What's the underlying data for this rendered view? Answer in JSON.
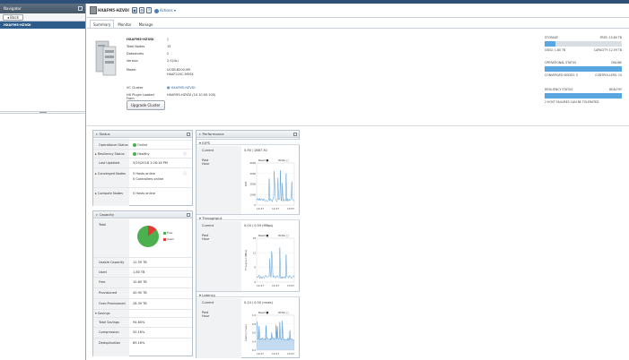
{
  "navigator": {
    "title": "Navigator",
    "back_label": "Back",
    "selected_item": "HXAFM5-HZVDI"
  },
  "header": {
    "object_name": "HXAFM5-HZVDI",
    "actions_label": "Actions",
    "toolbar_icons": [
      "snapshot-icon",
      "manage-icon",
      "help-icon"
    ]
  },
  "tabs": [
    {
      "label": "Summary",
      "active": true
    },
    {
      "label": "Monitor",
      "active": false
    },
    {
      "label": "Manage",
      "active": false
    }
  ],
  "summary": {
    "name": "HXAFM5-HZVDI",
    "fields": [
      {
        "key": "Total Nodes",
        "value": "15"
      },
      {
        "key": "Datastores",
        "value": "2"
      },
      {
        "key": "Version",
        "value": "2.5(1b)"
      },
      {
        "key": "Model",
        "value": "UCSB-B200-M5  HXAF220C-M5SX"
      }
    ],
    "vc_cluster_key": "VC Cluster",
    "vc_cluster_value": "HXAFM5-HZVDI",
    "plugin_key": "HX Plugin Loaded From",
    "plugin_value": "HXAFM5-HZVDI (10.10.50.100)",
    "upgrade_label": "Upgrade Cluster"
  },
  "right_panel": {
    "storage_label": "STORAGE",
    "free_label": "FREE: 10.80 TB",
    "used_label": "USED: 1.80 TB",
    "capacity_label": "CAPACITY: 12.59 TB",
    "storage_used_fraction": 0.14,
    "op_status_label": "OPERATIONAL STATUS",
    "op_status_value": "ONLINE",
    "converged_label": "CONVERGED NODES: 5",
    "controllers_label": "CONTROLLERS: 10",
    "op_fraction": 1.0,
    "resiliency_label": "RESILIENCY STATUS",
    "resiliency_value": "HEALTHY",
    "resiliency_fraction": 1.0,
    "tolerated_label": "2 HOST FAILURES CAN BE TOLERATED"
  },
  "status": {
    "title": "Status",
    "rows": [
      {
        "key": "Operational Status",
        "value": "Online",
        "dot": "#4caf50"
      },
      {
        "key": "Resiliency Status",
        "value": "Healthy",
        "dot": "#4caf50"
      },
      {
        "key": "Last Updated",
        "value": "5/25/2018 1:26:16 PM"
      },
      {
        "key": "Converged Nodes",
        "value": "5 Hosts online",
        "value2": "0 Controllers online"
      },
      {
        "key": "Compute Nodes",
        "value": "0 Hosts online"
      }
    ]
  },
  "capacity": {
    "title": "Capacity",
    "total_label": "Total",
    "legend_free": "Free",
    "legend_used": "Used",
    "free_color": "#4caf50",
    "used_color": "#e53935",
    "used_fraction": 0.14,
    "rows": [
      {
        "key": "Usable Capacity",
        "value": "12.59 TB"
      },
      {
        "key": "Used",
        "value": "1.80 TB"
      },
      {
        "key": "Free",
        "value": "10.80 TB"
      },
      {
        "key": "Provisioned",
        "value": "40.90 TB"
      },
      {
        "key": "Over-Provisioned",
        "value": "28.39 TB"
      }
    ],
    "savings_label": "Savings",
    "savings_rows": [
      {
        "key": "Total Savings",
        "value": "94.60%"
      },
      {
        "key": "Compression",
        "value": "50.16%"
      },
      {
        "key": "Deduplication",
        "value": "89.16%"
      }
    ]
  },
  "performance": {
    "title": "Performance",
    "sections": [
      {
        "name": "IOPS",
        "current_key": "Current",
        "current_value": "5.90 / 2887.30",
        "period_key": "Past Hour",
        "ylabel": "IOPS",
        "yticks": [
          "4000",
          "3000",
          "2000",
          "1000",
          "0"
        ],
        "xticks": [
          "12:27",
          "12:47",
          "13:07"
        ]
      },
      {
        "name": "Throughput",
        "current_key": "Current",
        "current_value": "0.04 / 0.59 (MBps)",
        "period_key": "Past Hour",
        "ylabel": "Throughput (MBps)",
        "yticks": [
          "18",
          "12",
          "6",
          "0"
        ],
        "xticks": [
          "12:27",
          "12:47",
          "13:07"
        ]
      },
      {
        "name": "Latency",
        "current_key": "Current",
        "current_value": "0.24 / 0.50 (msec)",
        "period_key": "Past Hour",
        "ylabel": "Latency (msec)",
        "yticks": [
          "1.0",
          "0.8",
          "0.6",
          "0.4",
          "0.2"
        ],
        "xticks": [
          "12:27",
          "12:47",
          "13:07"
        ]
      }
    ],
    "legend_read": "Read",
    "legend_write": "Write"
  }
}
